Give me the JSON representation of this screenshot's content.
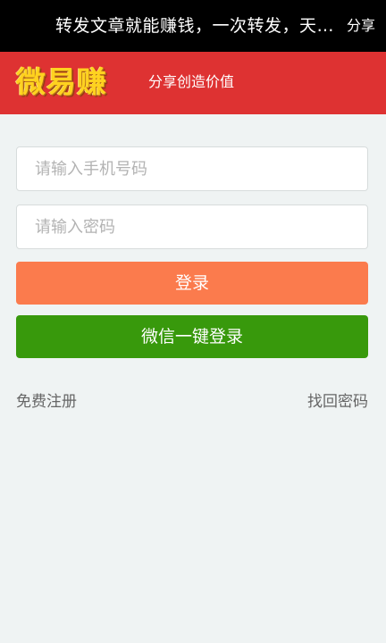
{
  "top_bar": {
    "title": "转发文章就能赚钱，一次转发，天天赚钱",
    "share_label": "分享"
  },
  "brand": {
    "logo_text": "微易赚",
    "slogan": "分享创造价值"
  },
  "form": {
    "phone_placeholder": "请输入手机号码",
    "phone_value": "",
    "password_placeholder": "请输入密码",
    "password_value": "",
    "login_label": "登录",
    "wechat_login_label": "微信一键登录"
  },
  "links": {
    "register": "免费注册",
    "recover_password": "找回密码"
  },
  "colors": {
    "top_bar": "#000000",
    "brand_bar": "#de3232",
    "logo": "#ffd21f",
    "login_button": "#fb7b4d",
    "wechat_button": "#38990c",
    "page_background": "#eff3f3"
  }
}
